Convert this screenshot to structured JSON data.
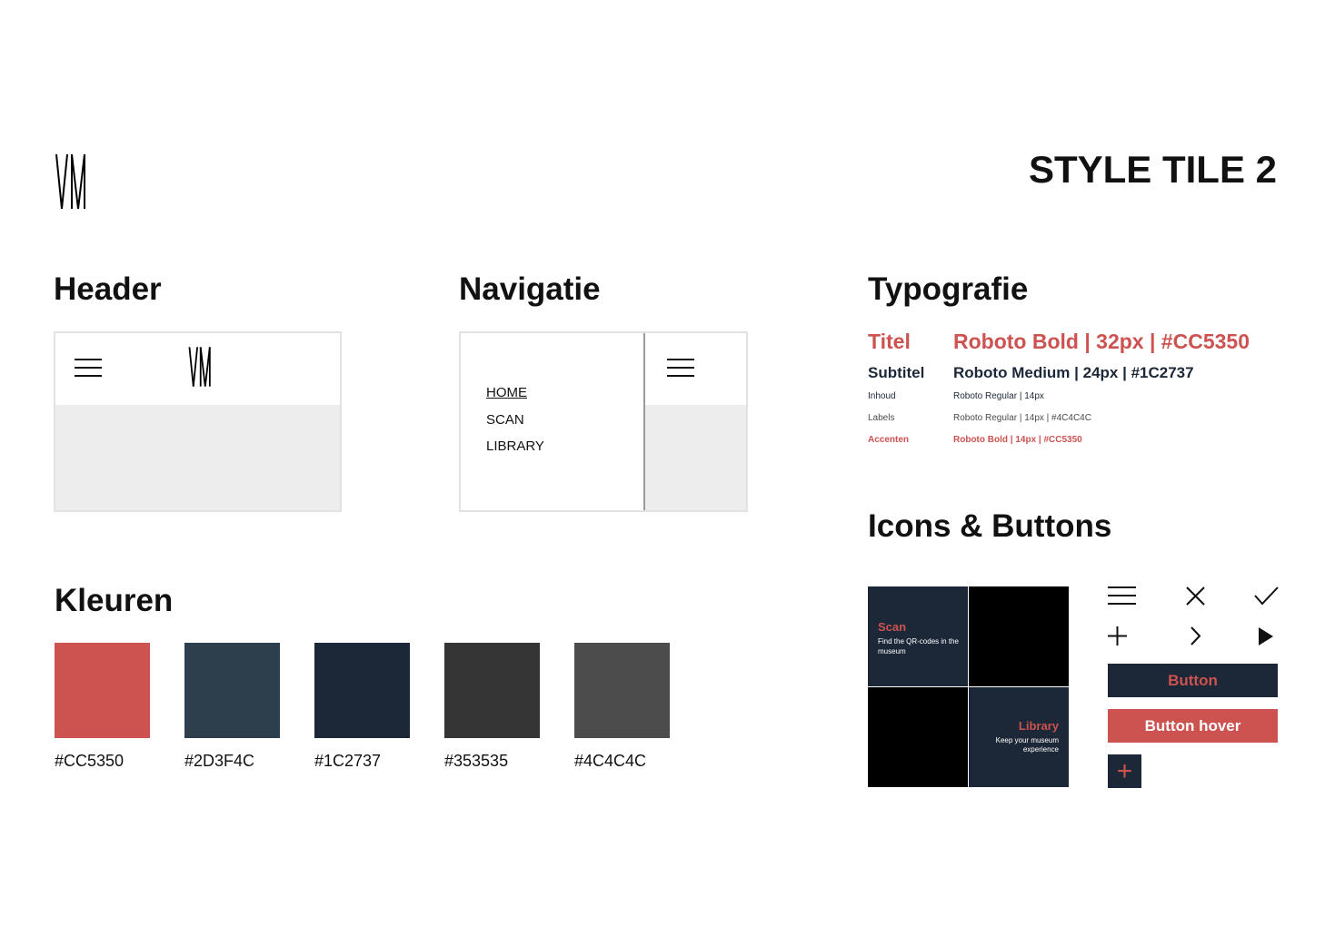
{
  "page": {
    "title": "STYLE TILE 2"
  },
  "logo": {
    "text": "VM"
  },
  "sections": {
    "header": "Header",
    "navigatie": "Navigatie",
    "typografie": "Typografie",
    "kleuren": "Kleuren",
    "icons_buttons": "Icons & Buttons"
  },
  "navigation": {
    "items": [
      "HOME",
      "SCAN",
      "LIBRARY"
    ],
    "active": "HOME"
  },
  "typography": [
    {
      "label": "Titel",
      "spec": "Roboto Bold | 32px | #CC5350",
      "color": "#CC5350"
    },
    {
      "label": "Subtitel",
      "spec": "Roboto Medium | 24px | #1C2737",
      "color": "#1C2737"
    },
    {
      "label": "Inhoud",
      "spec": "Roboto Regular | 14px",
      "color": "#1C2737"
    },
    {
      "label": "Labels",
      "spec": "Roboto Regular | 14px | #4C4C4C",
      "color": "#4C4C4C"
    },
    {
      "label": "Accenten",
      "spec": "Roboto Bold | 14px | #CC5350",
      "color": "#CC5350"
    }
  ],
  "colors": [
    {
      "hex": "#CC5350",
      "label": "#CC5350"
    },
    {
      "hex": "#2D3F4C",
      "label": "#2D3F4C"
    },
    {
      "hex": "#1C2737",
      "label": "#1C2737"
    },
    {
      "hex": "#353535",
      "label": "#353535"
    },
    {
      "hex": "#4C4C4C",
      "label": "#4C4C4C"
    }
  ],
  "tiles": {
    "scan": {
      "title": "Scan",
      "text": "Find the QR-codes in the museum"
    },
    "library": {
      "title": "Library",
      "text": "Keep your museum experience"
    }
  },
  "icons": [
    "menu-icon",
    "close-icon",
    "check-icon",
    "plus-icon",
    "chevron-right-icon",
    "play-icon"
  ],
  "buttons": {
    "default": "Button",
    "hover": "Button hover",
    "add": "+"
  },
  "accent": "#CC5350",
  "dark": "#1C2737"
}
